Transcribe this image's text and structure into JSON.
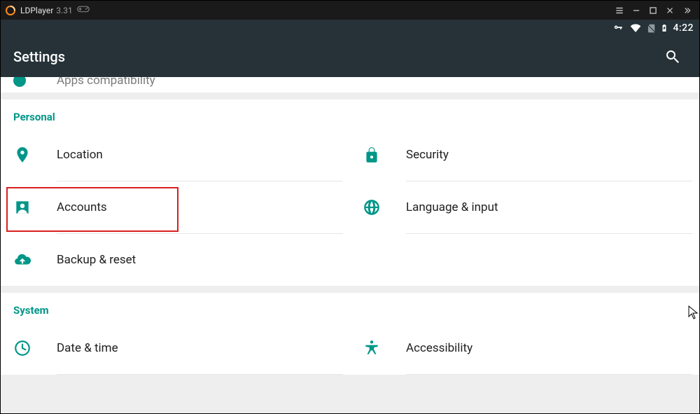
{
  "window": {
    "app_name": "LDPlayer",
    "app_version": "3.31"
  },
  "status_bar": {
    "clock": "4:22"
  },
  "app_bar": {
    "title": "Settings"
  },
  "top_peek": {
    "label": "Apps compatibility"
  },
  "sections": {
    "personal": {
      "header": "Personal",
      "location": "Location",
      "security": "Security",
      "accounts": "Accounts",
      "language": "Language & input",
      "backup": "Backup & reset"
    },
    "system": {
      "header": "System",
      "datetime": "Date & time",
      "accessibility": "Accessibility"
    }
  }
}
